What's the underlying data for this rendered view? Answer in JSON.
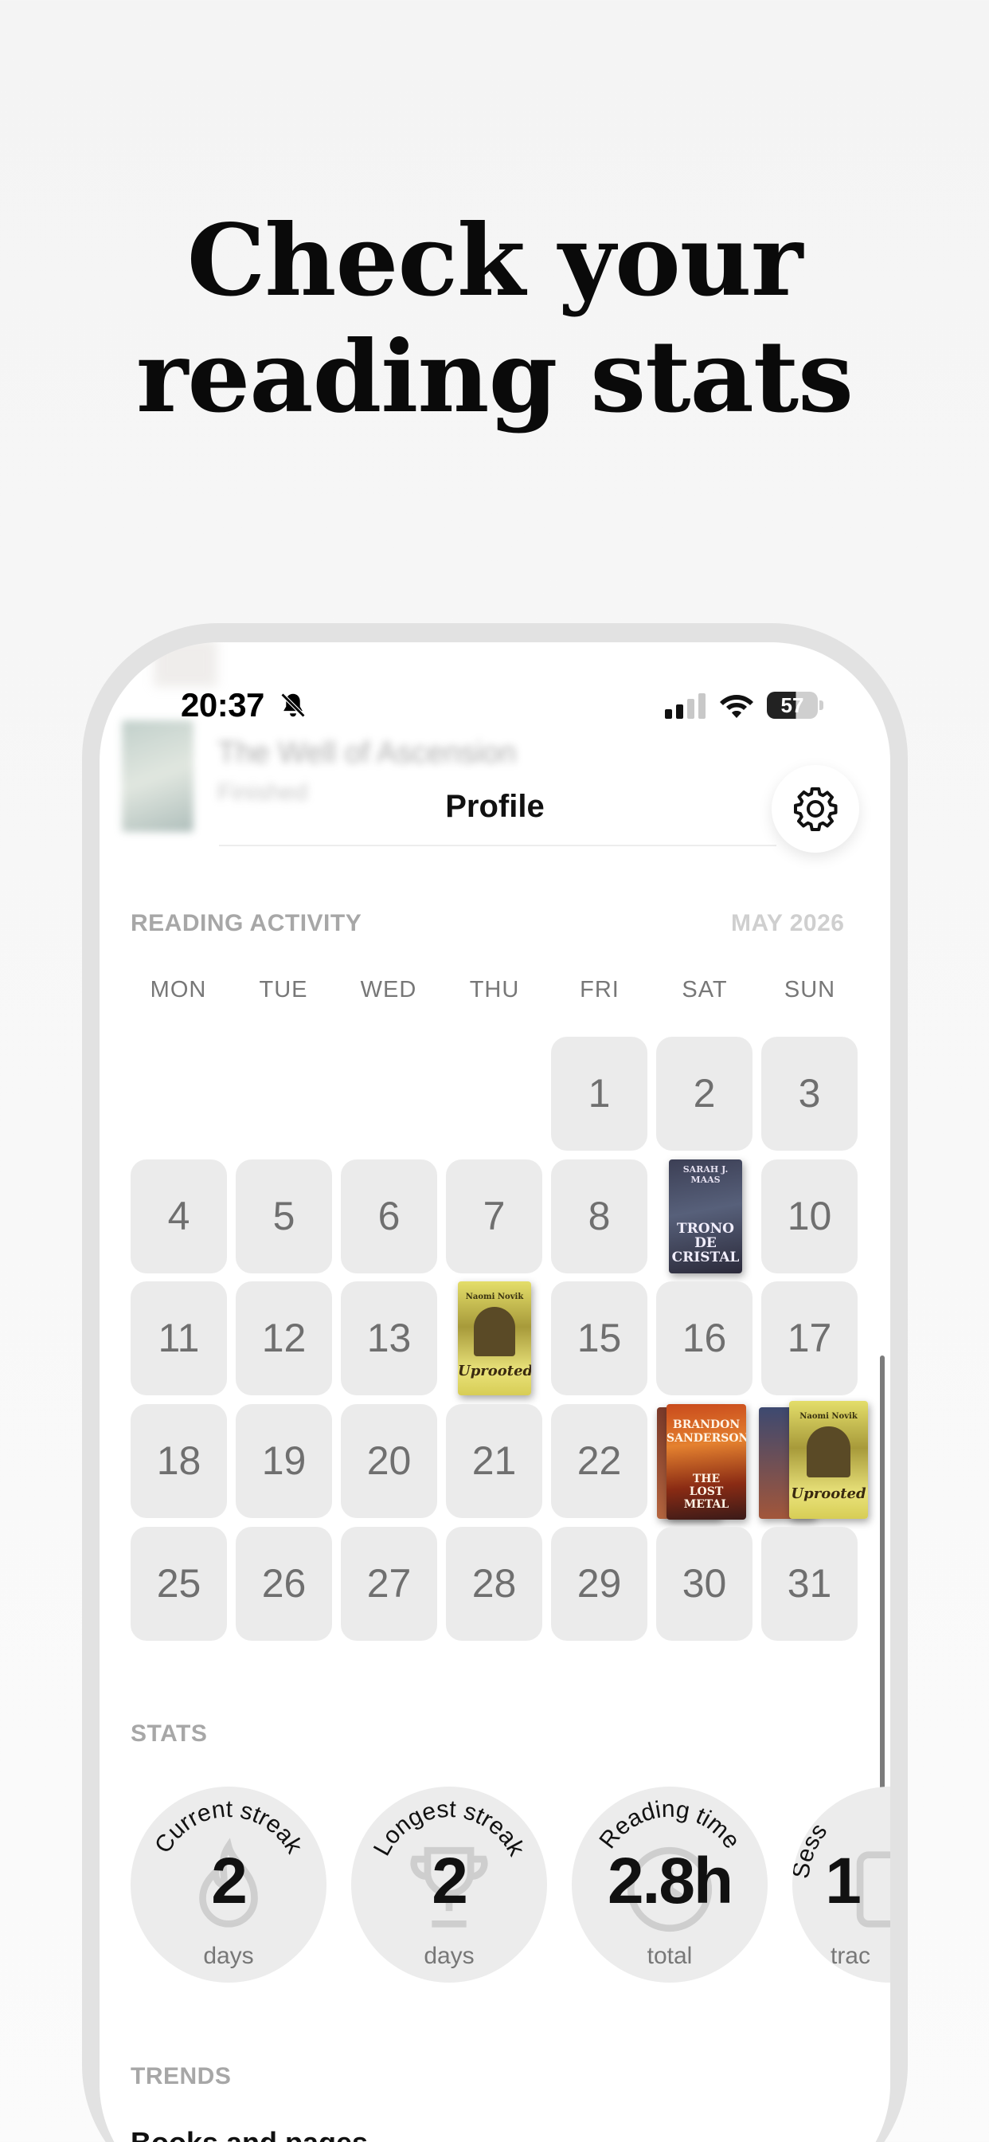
{
  "headline": {
    "line1": "Check your",
    "line2": "reading stats"
  },
  "status_bar": {
    "time": "20:37",
    "battery": "57"
  },
  "peek_item": {
    "title": "The Well of Ascension",
    "subtitle": "Finished"
  },
  "header": {
    "title": "Profile"
  },
  "activity": {
    "label": "READING ACTIVITY",
    "month": "MAY 2026",
    "weekdays": [
      "MON",
      "TUE",
      "WED",
      "THU",
      "FRI",
      "SAT",
      "SUN"
    ],
    "days": [
      "1",
      "2",
      "3",
      "4",
      "5",
      "6",
      "7",
      "8",
      "9",
      "10",
      "11",
      "12",
      "13",
      "14",
      "15",
      "16",
      "17",
      "18",
      "19",
      "20",
      "21",
      "22",
      "23",
      "24",
      "25",
      "26",
      "27",
      "28",
      "29",
      "30",
      "31"
    ],
    "book_days": {
      "9": {
        "title_lines": [
          "TRONO",
          "DE",
          "CRISTAL"
        ],
        "author": "SARAH J. MAAS"
      },
      "14": {
        "title": "Uprooted",
        "author": "Naomi Novik"
      },
      "23": {
        "title_lines": [
          "BRANDON",
          "SANDERSON",
          "THE",
          "LOST",
          "METAL"
        ]
      },
      "24": {
        "title": "Uprooted",
        "author": "Naomi Novik"
      }
    }
  },
  "stats": {
    "label": "STATS",
    "items": [
      {
        "title": "Current streak",
        "value": "2",
        "unit": "days",
        "icon": "flame-icon"
      },
      {
        "title": "Longest streak",
        "value": "2",
        "unit": "days",
        "icon": "trophy-icon"
      },
      {
        "title": "Reading time",
        "value": "2.8h",
        "unit": "total",
        "icon": "clock-icon"
      },
      {
        "title": "Sess",
        "value": "1",
        "unit": "trac",
        "icon": "book-icon"
      }
    ]
  },
  "trends": {
    "label": "TRENDS",
    "subtitle": "Books and pages"
  },
  "colors": {
    "accent": "#111111",
    "day_cell": "#ebebeb",
    "stat_circle": "#ececec"
  }
}
